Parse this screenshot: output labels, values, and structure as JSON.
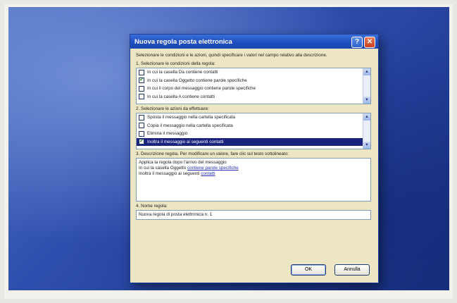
{
  "dialog": {
    "title": "Nuova regola posta elettronica",
    "intro": "Selezionare le condizioni e le azioni, quindi specificare i valori nel campo relativo alla descrizione.",
    "step1_label": "1. Selezionare le condizioni della regola:",
    "conditions": [
      {
        "label": "In cui la casella Da contiene contatti",
        "checked": false
      },
      {
        "label": "In cui la casella Oggetto contiene parole specifiche",
        "checked": true
      },
      {
        "label": "In cui il corpo del messaggio contiene parole specifiche",
        "checked": false
      },
      {
        "label": "In cui la casella A contiene contatti",
        "checked": false
      }
    ],
    "step2_label": "2. Selezionare le azioni da effettuare:",
    "actions": [
      {
        "label": "Sposta il messaggio nella cartella specificata",
        "checked": false
      },
      {
        "label": "Copia il messaggio nella cartella specificata",
        "checked": false
      },
      {
        "label": "Elimina il messaggio",
        "checked": false
      },
      {
        "label": "Inoltra il messaggio ai seguenti contatti",
        "checked": true,
        "selected": true
      }
    ],
    "step3_label": "3. Descrizione regola. Per modificare un valore, fare clic sul testo sottolineato:",
    "description": {
      "line1": "Applica la regola dopo l'arrivo del messaggio",
      "line2_prefix": "In cui la casella Oggetto ",
      "line2_link": "contiene parole specifiche",
      "line3_prefix": "Inoltra il messaggio ai seguenti ",
      "line3_link": "contatti"
    },
    "step4_label": "4. Nome regola:",
    "rule_name": "Nuova regola di posta elettronica n. 1",
    "ok_label": "OK",
    "cancel_label": "Annulla",
    "help_glyph": "?",
    "close_glyph": "✕",
    "check_glyph": "✔"
  }
}
